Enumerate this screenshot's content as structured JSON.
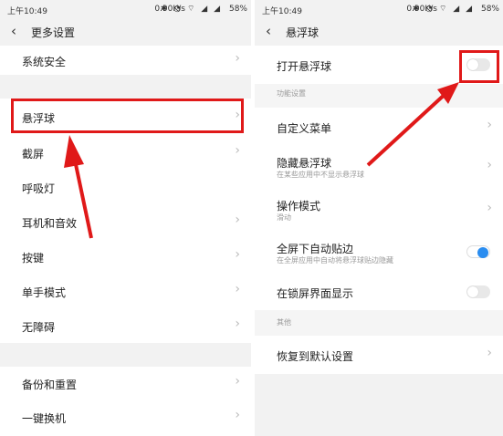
{
  "left": {
    "status": {
      "time": "上午10:49",
      "net": "0.00K/s",
      "icons": "✱ ◔ ⌔ ◢ ◢",
      "battery": "58%"
    },
    "header": {
      "back": "‹",
      "title": "更多设置"
    },
    "items": [
      {
        "label": "系统安全"
      },
      {
        "label": "悬浮球"
      },
      {
        "label": "截屏"
      },
      {
        "label": "呼吸灯"
      },
      {
        "label": "耳机和音效"
      },
      {
        "label": "按键"
      },
      {
        "label": "单手模式"
      },
      {
        "label": "无障碍"
      },
      {
        "label": "备份和重置"
      },
      {
        "label": "一键换机"
      }
    ]
  },
  "right": {
    "status": {
      "time": "上午10:49",
      "net": "0.00K/s",
      "icons": "✱ ◔ ⌔ ◢ ◢",
      "battery": "58%"
    },
    "header": {
      "back": "‹",
      "title": "悬浮球"
    },
    "open_float_ball": {
      "label": "打开悬浮球",
      "on": false
    },
    "section_function": "功能设置",
    "custom_menu": {
      "label": "自定义菜单"
    },
    "hide_ball": {
      "label": "隐藏悬浮球",
      "sub": "在某些应用中不显示悬浮球"
    },
    "operation_mode": {
      "label": "操作模式",
      "sub": "滑动"
    },
    "fullscreen_edge": {
      "label": "全屏下自动贴边",
      "sub": "在全屏应用中自动将悬浮球贴边隐藏",
      "on": true
    },
    "lockscreen_show": {
      "label": "在锁屏界面显示",
      "on": false
    },
    "section_other": "其他",
    "restore_default": {
      "label": "恢复到默认设置"
    }
  },
  "colors": {
    "highlight": "#e01919",
    "accent": "#2a8df0"
  }
}
